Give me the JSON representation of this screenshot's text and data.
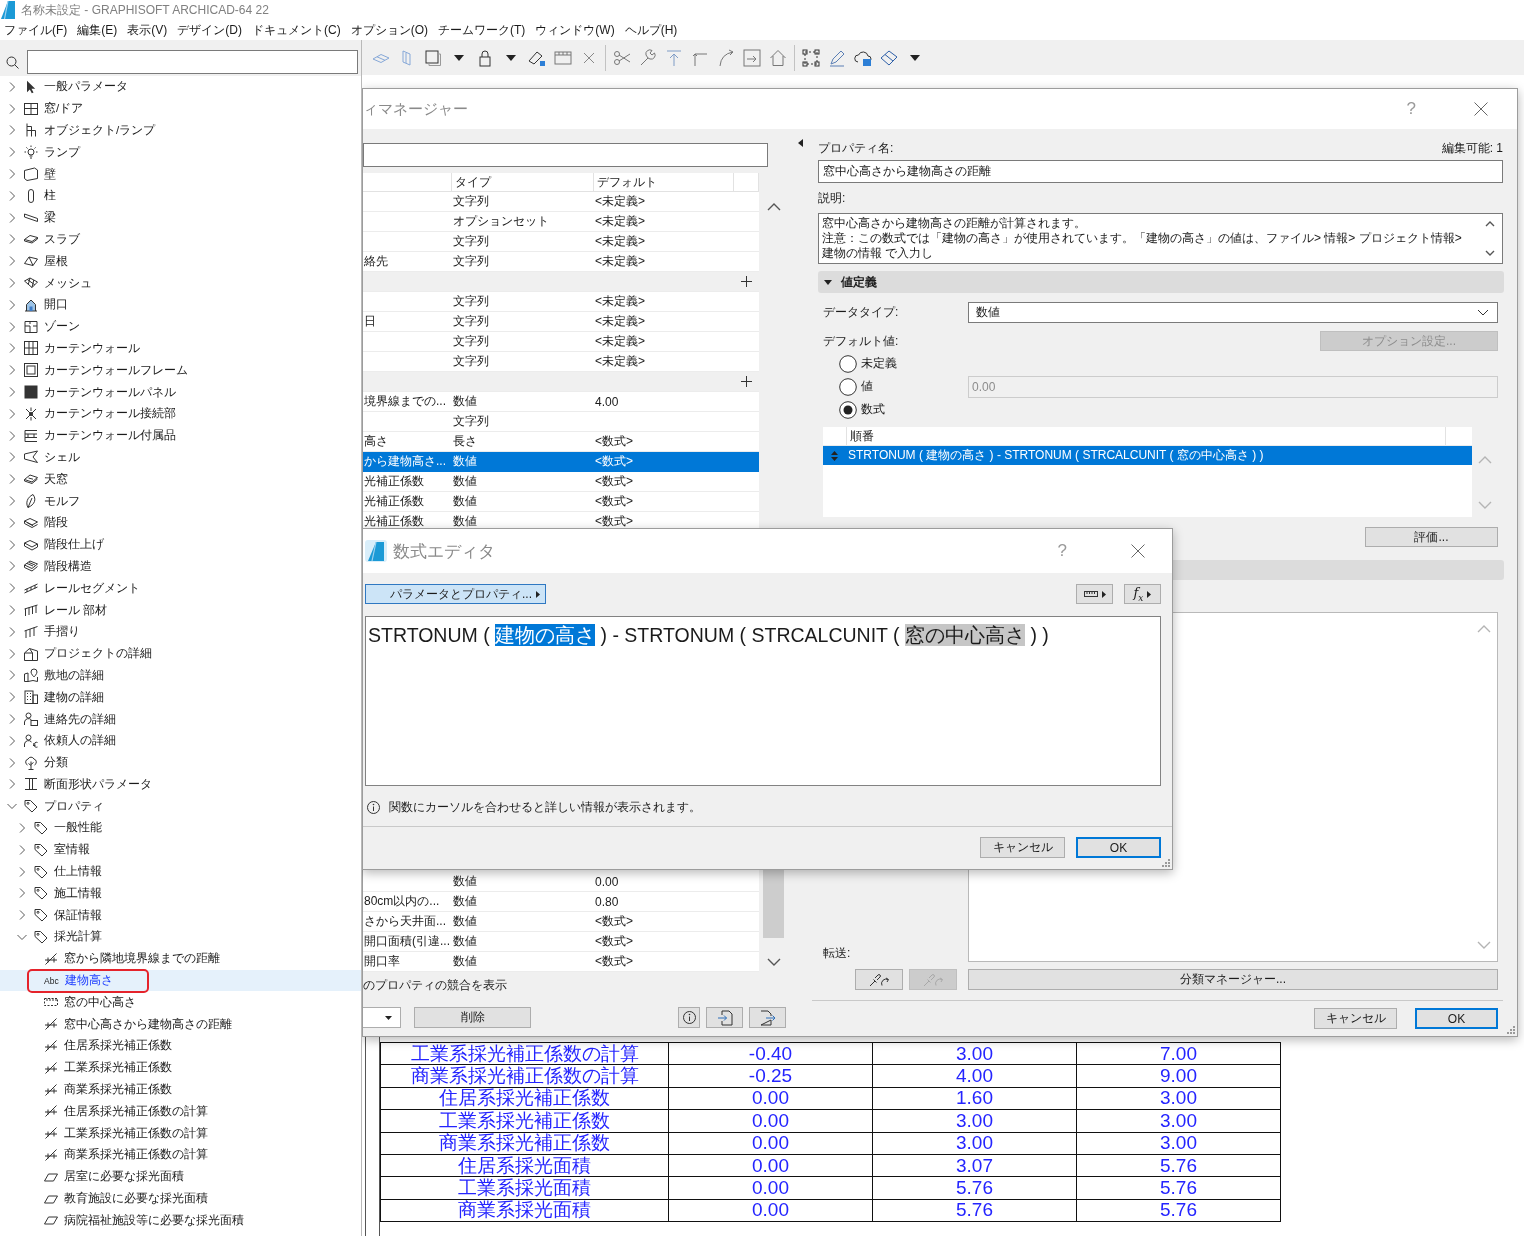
{
  "window": {
    "title": "名称未設定 - GRAPHISOFT ARCHICAD-64 22"
  },
  "menu": [
    "ファイル(F)",
    "編集(E)",
    "表示(V)",
    "デザイン(D)",
    "ドキュメント(C)",
    "オプション(O)",
    "チームワーク(T)",
    "ウィンドウ(W)",
    "ヘルプ(H)"
  ],
  "navigator": {
    "items": [
      {
        "label": "一般パラメータ",
        "expanded": false,
        "selected": false
      },
      {
        "label": "窓/ドア",
        "expanded": false,
        "selected": false
      },
      {
        "label": "オブジェクト/ランプ",
        "expanded": false,
        "selected": false
      },
      {
        "label": "ランプ",
        "expanded": false,
        "selected": false
      },
      {
        "label": "壁",
        "expanded": false,
        "selected": false
      },
      {
        "label": "柱",
        "expanded": false,
        "selected": false
      },
      {
        "label": "梁",
        "expanded": false,
        "selected": false
      },
      {
        "label": "スラブ",
        "expanded": false,
        "selected": false
      },
      {
        "label": "屋根",
        "expanded": false,
        "selected": false
      },
      {
        "label": "メッシュ",
        "expanded": false,
        "selected": false
      },
      {
        "label": "開口",
        "expanded": false,
        "selected": false
      },
      {
        "label": "ゾーン",
        "expanded": false,
        "selected": false
      },
      {
        "label": "カーテンウォール",
        "expanded": false,
        "selected": false
      },
      {
        "label": "カーテンウォールフレーム",
        "expanded": false,
        "selected": false
      },
      {
        "label": "カーテンウォールパネル",
        "expanded": false,
        "selected": false
      },
      {
        "label": "カーテンウォール接続部",
        "expanded": false,
        "selected": false
      },
      {
        "label": "カーテンウォール付属品",
        "expanded": false,
        "selected": false
      },
      {
        "label": "シェル",
        "expanded": false,
        "selected": false
      },
      {
        "label": "天窓",
        "expanded": false,
        "selected": false
      },
      {
        "label": "モルフ",
        "expanded": false,
        "selected": false
      },
      {
        "label": "階段",
        "expanded": false,
        "selected": false
      },
      {
        "label": "階段仕上げ",
        "expanded": false,
        "selected": false
      },
      {
        "label": "階段構造",
        "expanded": false,
        "selected": false
      },
      {
        "label": "レールセグメント",
        "expanded": false,
        "selected": false
      },
      {
        "label": "レール 部材",
        "expanded": false,
        "selected": false
      },
      {
        "label": "手摺り",
        "expanded": false,
        "selected": false
      },
      {
        "label": "プロジェクトの詳細",
        "expanded": false,
        "selected": false
      },
      {
        "label": "敷地の詳細",
        "expanded": false,
        "selected": false
      },
      {
        "label": "建物の詳細",
        "expanded": false,
        "selected": false
      },
      {
        "label": "連絡先の詳細",
        "expanded": false,
        "selected": false
      },
      {
        "label": "依頼人の詳細",
        "expanded": false,
        "selected": false
      },
      {
        "label": "分類",
        "expanded": false,
        "selected": false
      },
      {
        "label": "断面形状パラメータ",
        "expanded": false,
        "selected": false
      },
      {
        "label": "プロパティ",
        "expanded": true,
        "selected": false,
        "children": [
          {
            "label": "一般性能",
            "expanded": false,
            "selected": false
          },
          {
            "label": "室情報",
            "expanded": false,
            "selected": false
          },
          {
            "label": "仕上情報",
            "expanded": false,
            "selected": false
          },
          {
            "label": "施工情報",
            "expanded": false,
            "selected": false
          },
          {
            "label": "保証情報",
            "expanded": false,
            "selected": false
          },
          {
            "label": "採光計算",
            "expanded": true,
            "selected": false,
            "children": [
              {
                "label": "窓から隣地境界線までの距離",
                "kind": "number",
                "selected": false,
                "marked": false
              },
              {
                "label": "建物高さ",
                "kind": "text",
                "badge": "Abc",
                "selected": true,
                "marked": true
              },
              {
                "label": "窓の中心高さ",
                "kind": "length",
                "selected": false,
                "marked": false
              },
              {
                "label": "窓中心高さから建物高さの距離",
                "kind": "number",
                "selected": false,
                "marked": false
              },
              {
                "label": "住居系採光補正係数",
                "kind": "number",
                "selected": false,
                "marked": false
              },
              {
                "label": "工業系採光補正係数",
                "kind": "number",
                "selected": false,
                "marked": false
              },
              {
                "label": "商業系採光補正係数",
                "kind": "number",
                "selected": false,
                "marked": false
              },
              {
                "label": "住居系採光補正係数の計算",
                "kind": "number",
                "selected": false,
                "marked": false
              },
              {
                "label": "工業系採光補正係数の計算",
                "kind": "number",
                "selected": false,
                "marked": false
              },
              {
                "label": "商業系採光補正係数の計算",
                "kind": "number",
                "selected": false,
                "marked": false
              },
              {
                "label": "居室に必要な採光面積",
                "kind": "area",
                "selected": false,
                "marked": false
              },
              {
                "label": "教育施設に必要な採光面積",
                "kind": "area",
                "selected": false,
                "marked": false
              },
              {
                "label": "病院福祉施設等に必要な採光面積",
                "kind": "area",
                "selected": false,
                "marked": false
              }
            ]
          }
        ]
      }
    ]
  },
  "property_manager": {
    "title": "ィマネージャー",
    "help": "?",
    "table": {
      "columns": [
        "タイプ",
        "デフォルト"
      ],
      "rows_above": [
        {
          "kind": "property",
          "type": "文字列",
          "default": "<未定義>",
          "selected": false
        },
        {
          "kind": "property",
          "type": "オプションセット",
          "default": "<未定義>",
          "selected": false
        },
        {
          "kind": "property",
          "type": "文字列",
          "default": "<未定義>",
          "selected": false
        },
        {
          "kind": "property",
          "name": "絡先",
          "type": "文字列",
          "default": "<未定義>",
          "selected": false
        },
        {
          "kind": "group"
        },
        {
          "kind": "property",
          "type": "文字列",
          "default": "<未定義>",
          "selected": false
        },
        {
          "kind": "property",
          "name": "日",
          "type": "文字列",
          "default": "<未定義>",
          "selected": false
        },
        {
          "kind": "property",
          "type": "文字列",
          "default": "<未定義>",
          "selected": false
        },
        {
          "kind": "property",
          "type": "文字列",
          "default": "<未定義>",
          "selected": false
        },
        {
          "kind": "group"
        },
        {
          "kind": "property",
          "name": "境界線までの...",
          "type": "数値",
          "default": "4.00",
          "selected": false
        },
        {
          "kind": "property",
          "type": "文字列",
          "selected": false
        },
        {
          "kind": "property",
          "name": "高さ",
          "type": "長さ",
          "default": "<数式>",
          "selected": false
        },
        {
          "kind": "property",
          "name": "から建物高さ...",
          "type": "数値",
          "default": "<数式>",
          "selected": true
        },
        {
          "kind": "property",
          "name": "光補正係数",
          "type": "数値",
          "default": "<数式>",
          "selected": false
        },
        {
          "kind": "property",
          "name": "光補正係数",
          "type": "数値",
          "default": "<数式>",
          "selected": false
        },
        {
          "kind": "property",
          "name": "光補正係数",
          "type": "数値",
          "default": "<数式>",
          "selected": false
        }
      ],
      "rows_below": [
        {
          "kind": "property",
          "type": "数値",
          "default": "0.00",
          "selected": false
        },
        {
          "kind": "property",
          "name": "80cm以内の...",
          "type": "数値",
          "default": "0.80",
          "selected": false
        },
        {
          "kind": "property",
          "name": "さから天井面...",
          "type": "数値",
          "default": "<数式>",
          "selected": false
        },
        {
          "kind": "property",
          "name": "開口面積(引違...",
          "type": "数値",
          "default": "<数式>",
          "selected": false
        },
        {
          "kind": "property",
          "name": "開口率",
          "type": "数値",
          "default": "<数式>",
          "selected": false
        }
      ]
    },
    "conflict_label": "のプロパティの競合を表示",
    "delete_button": "削除",
    "details": {
      "name_label": "プロパティ名:",
      "editable": "編集可能: 1",
      "name": "窓中心高さから建物高さの距離",
      "description_label": "説明:",
      "description": [
        "窓中心高さから建物高さの距離が計算されます。",
        "注意：この数式では「建物の高さ」が使用されています。「建物の高さ」の値は、ファイル> 情報> プロジェクト情報> 建物の情報 で入力し"
      ],
      "section": {
        "title": "値定義",
        "expanded": true
      },
      "data_type_label": "データタイプ:",
      "data_type": "数値",
      "default_label": "デフォルト値:",
      "options_button": {
        "label": "オプション設定...",
        "disabled": true
      },
      "default_options": [
        {
          "label": "未定義",
          "selected": false
        },
        {
          "label": "値",
          "selected": false,
          "field": {
            "value": "0.00",
            "disabled": true
          }
        },
        {
          "label": "数式",
          "selected": true
        }
      ],
      "formula_list": {
        "header": "順番",
        "rows": [
          {
            "text": "STRTONUM ( 建物の高さ ) - STRTONUM ( STRCALCUNIT ( 窓の中心高さ ) )",
            "selected": true
          }
        ]
      },
      "evaluate_button": "評価...",
      "transfer_label": "転送:",
      "transfer_buttons": [
        {
          "disabled": false
        },
        {
          "disabled": true
        }
      ],
      "classification_button": "分類マネージャー...",
      "buttons": [
        {
          "label": "キャンセル",
          "default": false
        },
        {
          "label": "OK",
          "default": true
        }
      ]
    }
  },
  "formula_editor": {
    "title": "数式エディタ",
    "help": "?",
    "parameters_button": "パラメータとプロパティ...",
    "function_button": "f$_{x}$",
    "formula": [
      {
        "text": "STRTONUM ( ",
        "kind": "plain"
      },
      {
        "text": "建物の高さ",
        "kind": "selection"
      },
      {
        "text": " ) - STRTONUM ( STRCALCUNIT ( ",
        "kind": "plain"
      },
      {
        "text": "窓の中心高さ",
        "kind": "token"
      },
      {
        "text": " ) )",
        "kind": "plain"
      }
    ],
    "hint": "関数にカーソルを合わせると詳しい情報が表示されます。",
    "buttons": [
      {
        "label": "キャンセル",
        "default": false
      },
      {
        "label": "OK",
        "default": true
      }
    ]
  },
  "document_table": {
    "rows": [
      [
        "工業系採光補正係数の計算",
        "-0.40",
        "3.00",
        "7.00"
      ],
      [
        "商業系採光補正係数の計算",
        "-0.25",
        "4.00",
        "9.00"
      ],
      [
        "住居系採光補正係数",
        "0.00",
        "1.60",
        "3.00"
      ],
      [
        "工業系採光補正係数",
        "0.00",
        "3.00",
        "3.00"
      ],
      [
        "商業系採光補正係数",
        "0.00",
        "3.00",
        "3.00"
      ],
      [
        "住居系採光面積",
        "0.00",
        "3.07",
        "5.76"
      ],
      [
        "工業系採光面積",
        "0.00",
        "5.76",
        "5.76"
      ],
      [
        "商業系採光面積",
        "0.00",
        "5.76",
        "5.76"
      ]
    ]
  }
}
